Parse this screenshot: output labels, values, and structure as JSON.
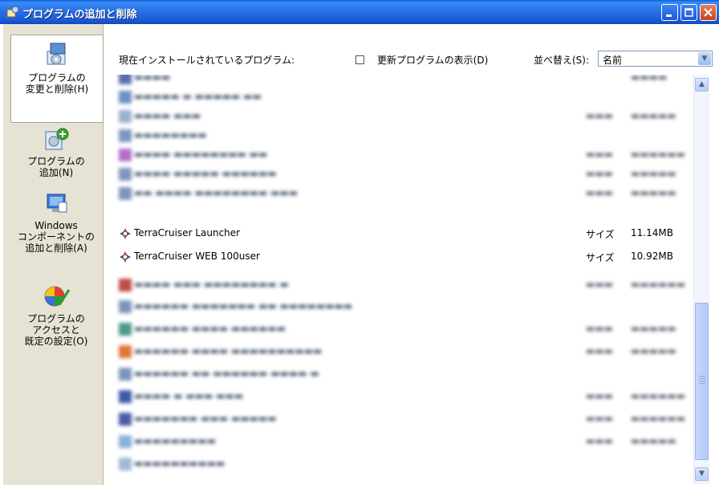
{
  "window": {
    "title": "プログラムの追加と削除"
  },
  "sidebar": {
    "items": [
      {
        "label": "プログラムの\n変更と削除(H)",
        "icon": "change-remove-programs-icon"
      },
      {
        "label": "プログラムの\n追加(N)",
        "icon": "add-programs-icon"
      },
      {
        "label": "Windows\nコンポーネントの\n追加と削除(A)",
        "icon": "windows-components-icon"
      },
      {
        "label": "プログラムの\nアクセスと\n既定の設定(O)",
        "icon": "program-access-defaults-icon"
      }
    ]
  },
  "header": {
    "installed_label": "現在インストールされているプログラム:",
    "show_updates_label": "更新プログラムの表示(D)",
    "sort_label": "並べ替え(S):",
    "sort_value": "名前"
  },
  "programs": [
    {
      "name": "TerraCruiser Launcher",
      "size_label": "サイズ",
      "size": "11.14MB"
    },
    {
      "name": "TerraCruiser WEB 100user",
      "size_label": "サイズ",
      "size": "10.92MB"
    }
  ],
  "colors": {
    "title_bar": "#2b74ea",
    "sidebar": "#e6e3d4",
    "close_button": "#d9532c"
  }
}
